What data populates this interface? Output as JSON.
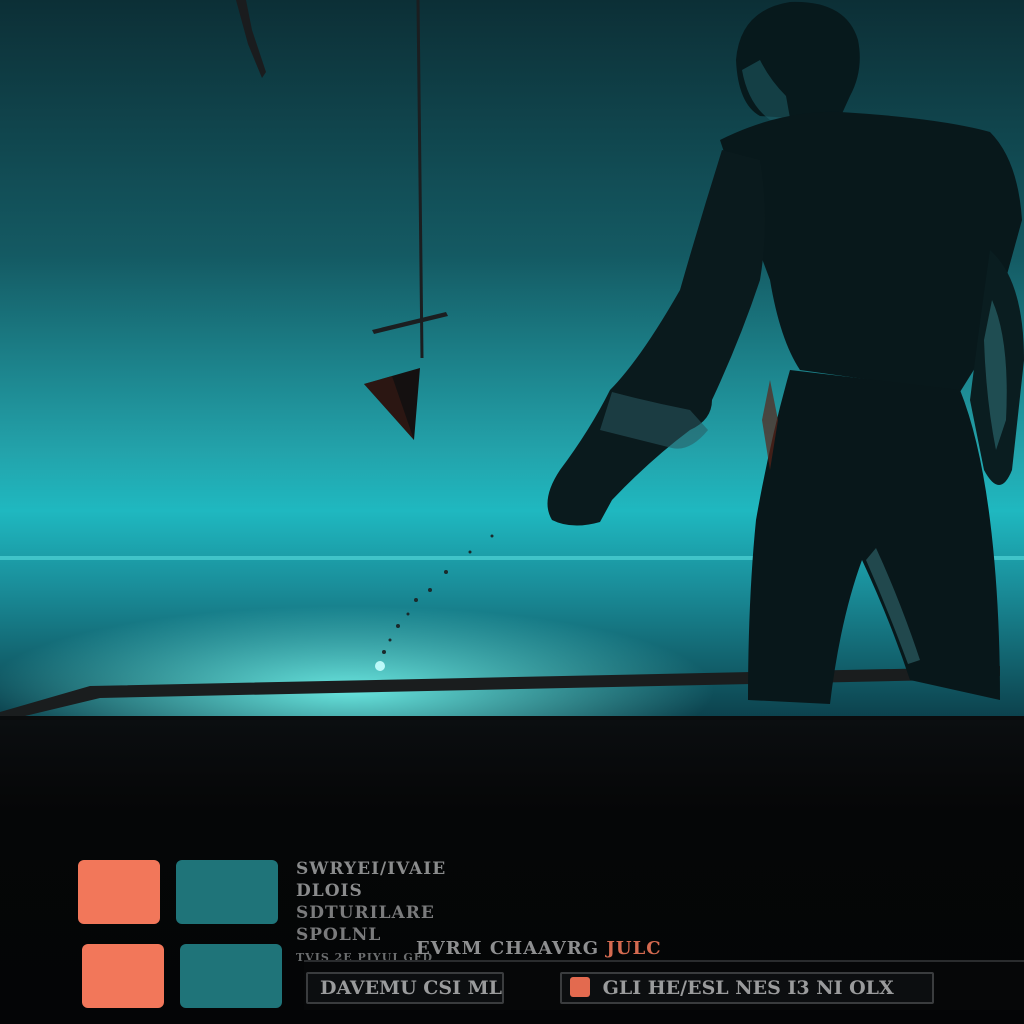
{
  "hud": {
    "info_line_1": "SWRYEI/IVAIE DLOIS",
    "info_line_2": "SDTURILARE SPOLNL",
    "info_line_3": "TVIS 2E PIYUI GFD",
    "status_left": "EVRM",
    "status_mid": "CHAAVRG",
    "status_right": "JULC",
    "slot_left_a": "DAVEMU",
    "slot_left_b": "CSI MLO",
    "slot_right_a": "GLI",
    "slot_right_b": "HE/ESL",
    "slot_right_c": "NES I3 NI OLX"
  },
  "colors": {
    "accent_orange": "#f2775a",
    "accent_teal": "#1f7479",
    "scene_glow": "#23c4c8"
  }
}
